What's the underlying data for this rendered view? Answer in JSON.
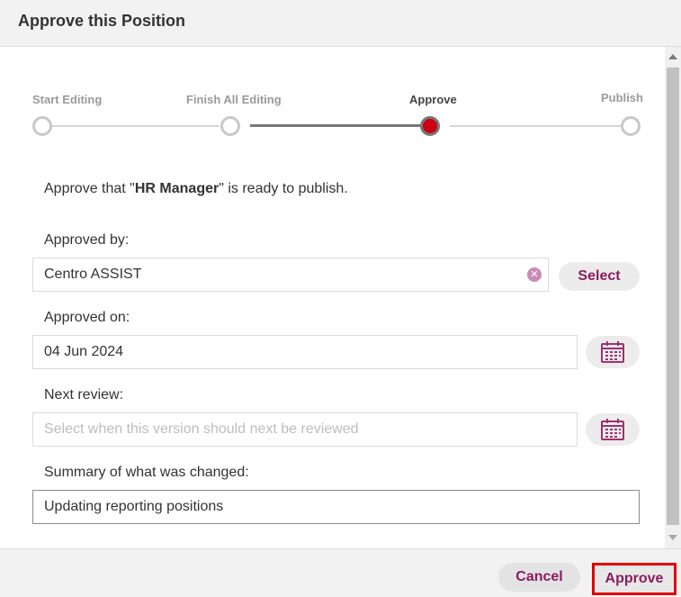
{
  "dialog": {
    "title": "Approve this Position"
  },
  "stepper": {
    "steps": [
      {
        "label": "Start Editing"
      },
      {
        "label": "Finish All Editing"
      },
      {
        "label": "Approve"
      },
      {
        "label": "Publish"
      }
    ],
    "active_index": 2
  },
  "intro": {
    "prefix": "Approve that \"",
    "position_name": "HR Manager",
    "suffix": "\" is ready to publish."
  },
  "approved_by": {
    "label": "Approved by:",
    "value": "Centro ASSIST",
    "select_label": "Select"
  },
  "approved_on": {
    "label": "Approved on:",
    "value": "04 Jun 2024"
  },
  "next_review": {
    "label": "Next review:",
    "placeholder": "Select when this version should next be reviewed"
  },
  "summary": {
    "label": "Summary of what was changed:",
    "value": "Updating reporting positions"
  },
  "footer": {
    "cancel_label": "Cancel",
    "approve_label": "Approve"
  },
  "colors": {
    "accent": "#8b1d5e",
    "active_step": "#cc0011",
    "highlight_border": "#e00000"
  }
}
